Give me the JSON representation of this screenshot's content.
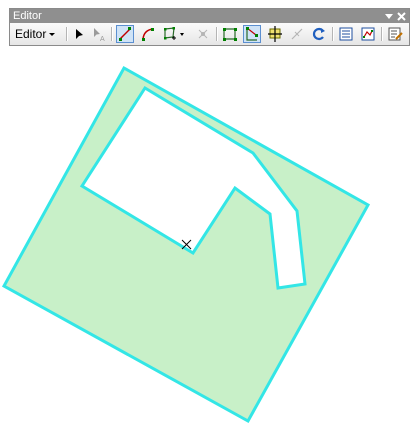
{
  "editor_toolbar": {
    "title": "Editor",
    "menu_label": "Editor",
    "tools": [
      {
        "name": "edit-tool"
      },
      {
        "name": "edit-annotation-tool"
      },
      {
        "name": "straight-segment-tool",
        "active": true
      },
      {
        "name": "end-point-arc-tool"
      },
      {
        "name": "trace-tool"
      },
      {
        "name": "point-tool"
      },
      {
        "name": "edit-vertices-tool",
        "active": false
      },
      {
        "name": "reshape-feature-tool",
        "active": true
      },
      {
        "name": "cut-polygons-tool"
      },
      {
        "name": "split-tool"
      },
      {
        "name": "rotate-tool"
      },
      {
        "name": "attributes-button"
      },
      {
        "name": "sketch-properties-button"
      },
      {
        "name": "create-features-button"
      }
    ]
  },
  "map": {
    "polygon_fill": "#c8f0c8",
    "polygon_outline": "#33e6e6",
    "background": "#ffffff"
  }
}
